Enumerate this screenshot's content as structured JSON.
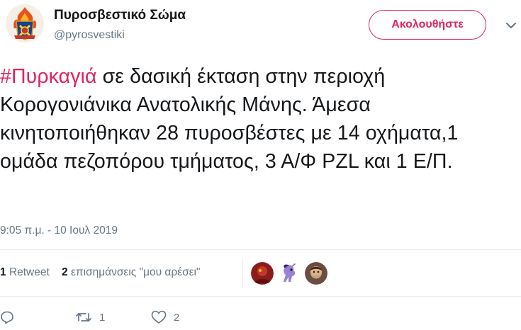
{
  "account": {
    "display_name": "Πυροσβεστικό Σώμα",
    "handle": "@pyrosvestiki",
    "avatar_icon": "fire-service-emblem"
  },
  "follow_button": {
    "label": "Ακολουθήστε",
    "color": "#e0245e"
  },
  "tweet": {
    "hashtag": "#Πυρκαγιά",
    "text": " σε δασική έκταση στην περιοχή Κορογονιάνικα Ανατολικής Μάνης. Άμεσα κινητοποιήθηκαν 28 πυροσβέστες με 14 οχήματα,1 ομάδα πεζοπόρου τμήματος, 3 Α/Φ PZL και 1 Ε/Π.",
    "timestamp": "9:05 π.μ. - 10 Ιουλ 2019"
  },
  "stats": {
    "retweets_count": "1",
    "retweets_label": "Retweet",
    "likes_count": "2",
    "likes_label": "επισημάνσεις \"μου αρέσει\""
  },
  "likers": [
    {
      "icon": "red-avatar"
    },
    {
      "icon": "pony-avatar"
    },
    {
      "icon": "bearded-man-avatar"
    }
  ],
  "actions": {
    "reply_icon": "reply-icon",
    "retweet_icon": "retweet-icon",
    "retweet_count": "1",
    "like_icon": "heart-icon",
    "like_count": "2"
  }
}
